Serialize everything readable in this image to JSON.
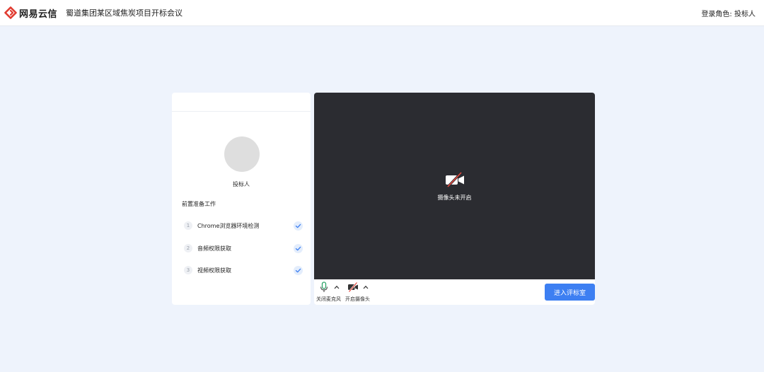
{
  "header": {
    "brand_name": "网易云信",
    "meeting_title": "蜀道集团某区域焦炭项目开标会议",
    "role_text": "登录角色: 投标人"
  },
  "left_panel": {
    "user_name": "投标人",
    "prep_title": "前置准备工作",
    "steps": [
      {
        "number": "1",
        "label": "Chrome浏览器环境检测",
        "status": "checked"
      },
      {
        "number": "2",
        "label": "音频权限获取",
        "status": "checked"
      },
      {
        "number": "3",
        "label": "视频权限获取",
        "status": "checked"
      }
    ]
  },
  "video": {
    "status_text": "摄像头未开启"
  },
  "controls": {
    "mic_label": "关闭麦克风",
    "camera_label": "开启摄像头",
    "enter_button": "进入评标室"
  },
  "colors": {
    "accent": "#3d7ff2",
    "brand_red": "#e03a2f",
    "page_bg": "#eef3fc",
    "video_bg": "#2b2c31"
  }
}
